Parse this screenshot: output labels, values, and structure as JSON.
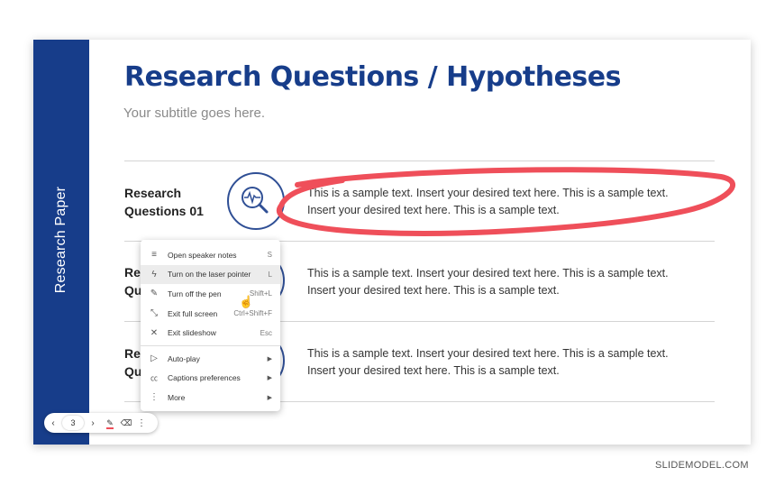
{
  "slide": {
    "side_label": "Research Paper",
    "title": "Research Questions / Hypotheses",
    "subtitle": "Your subtitle goes here.",
    "rows": [
      {
        "label_line1": "Research",
        "label_line2": "Questions 01",
        "icon": "magnifier-heartbeat-icon",
        "text": "This is a sample text. Insert your desired text here. This is a sample text. Insert your desired text here. This is a sample text."
      },
      {
        "label_line1": "Res",
        "label_line2": "Qu",
        "icon": "circle-icon",
        "text": "This is a sample text. Insert your desired text here. This is a sample text. Insert your desired text here. This is a sample text."
      },
      {
        "label_line1": "Res",
        "label_line2": "Qu",
        "icon": "circle-icon",
        "text": "This is a sample text. Insert your desired text here. This is a sample text. Insert your desired text here. This is a sample text."
      }
    ]
  },
  "menu": {
    "items": [
      {
        "icon": "notes-icon",
        "label": "Open speaker notes",
        "shortcut": "S"
      },
      {
        "icon": "laser-pointer-icon",
        "label": "Turn on the laser pointer",
        "shortcut": "L",
        "highlighted": true
      },
      {
        "icon": "pen-icon",
        "label": "Turn off the pen",
        "shortcut": "Shift+L"
      },
      {
        "icon": "exit-fullscreen-icon",
        "label": "Exit full screen",
        "shortcut": "Ctrl+Shift+F"
      },
      {
        "icon": "close-icon",
        "label": "Exit slideshow",
        "shortcut": "Esc"
      },
      {
        "icon": "play-icon",
        "label": "Auto-play",
        "submenu": true
      },
      {
        "icon": "captions-icon",
        "label": "Captions preferences",
        "submenu": true
      },
      {
        "icon": "more-icon",
        "label": "More",
        "submenu": true
      }
    ]
  },
  "toolbar": {
    "prev": "‹",
    "page": "3",
    "next": "›",
    "pen": "pen-icon",
    "eraser": "eraser-icon",
    "more": "⋮"
  },
  "watermark": "SLIDEMODEL.COM",
  "colors": {
    "brand_blue": "#173d8a",
    "annotation_red": "#ef4f5a"
  }
}
